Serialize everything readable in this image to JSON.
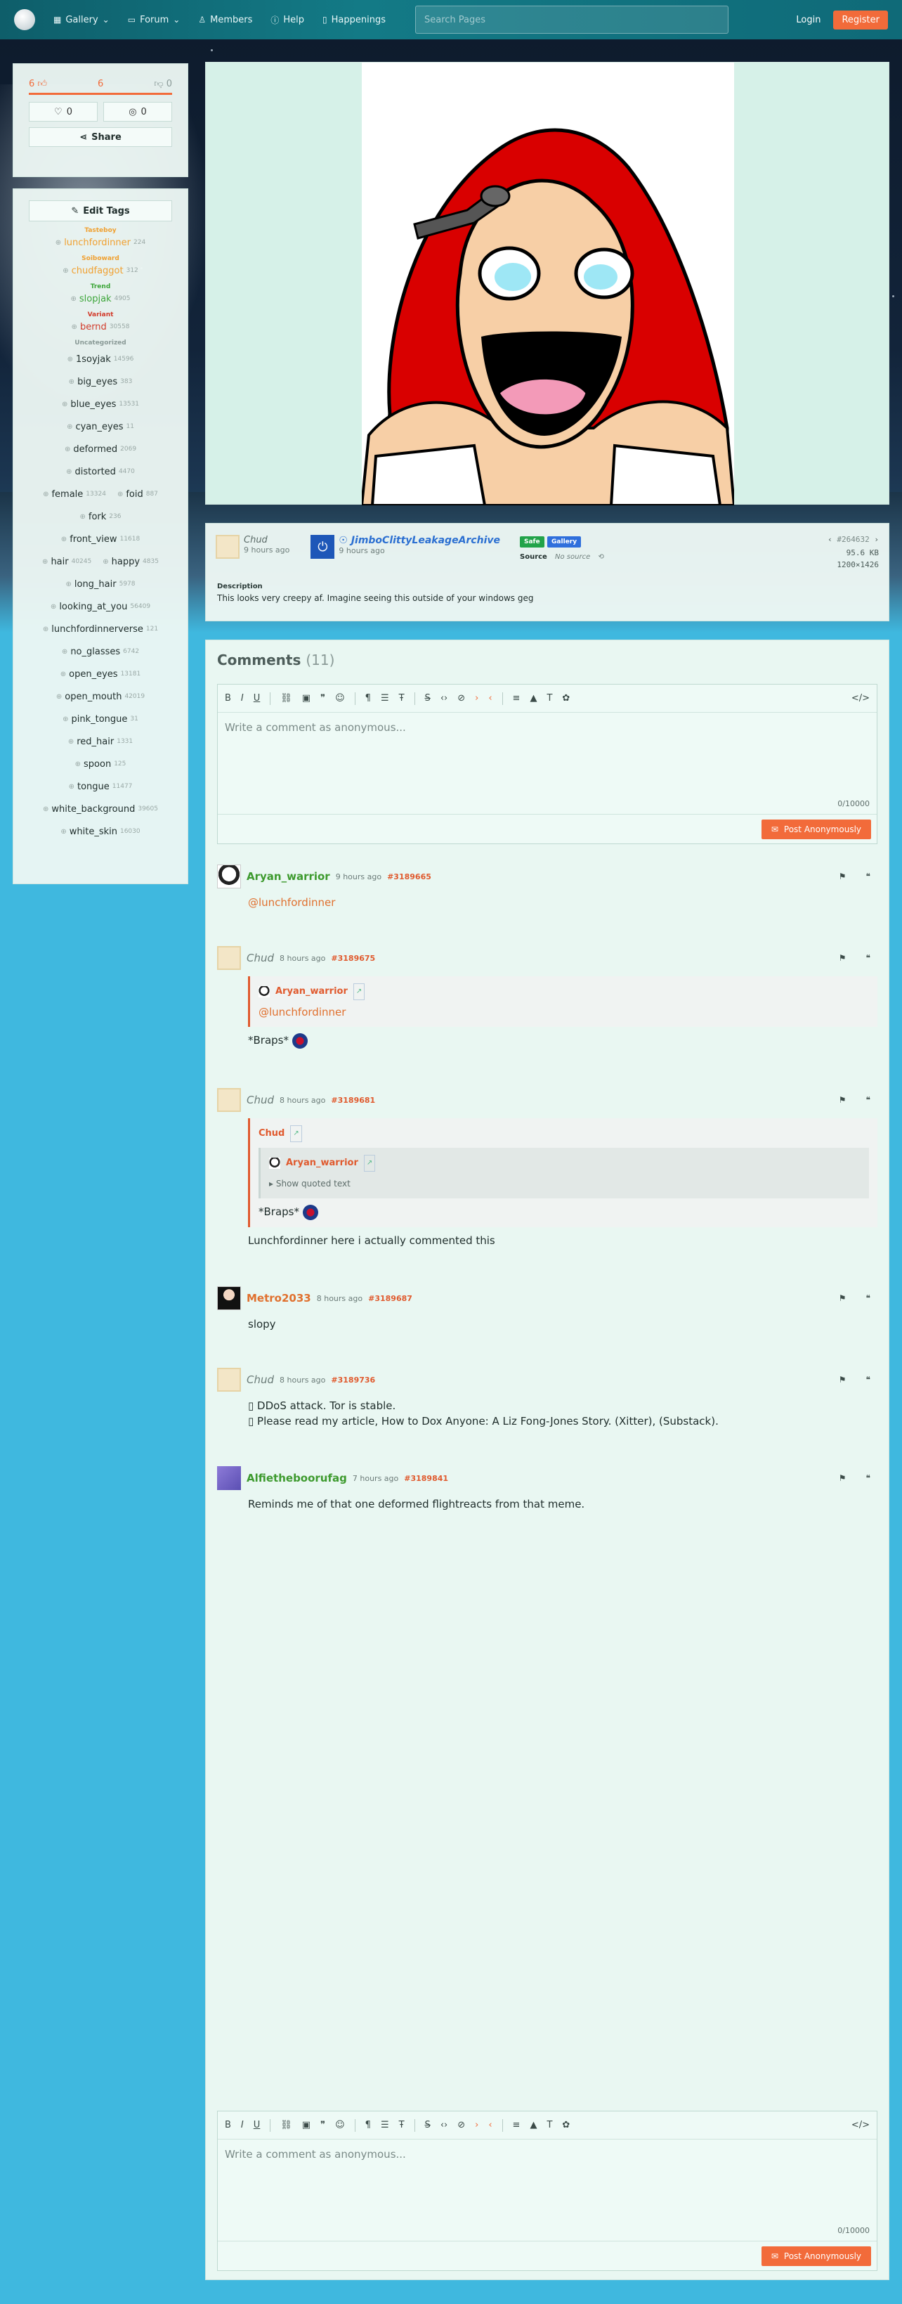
{
  "nav": {
    "gallery": "Gallery",
    "forum": "Forum",
    "members": "Members",
    "help": "Help",
    "happenings": "Happenings",
    "search_placeholder": "Search Pages",
    "login": "Login",
    "register": "Register"
  },
  "stats": {
    "upvotes": "6",
    "score": "6",
    "downvotes": "0",
    "favorites": "0",
    "hidden": "0",
    "share": "Share"
  },
  "tags": {
    "edit_label": "Edit Tags",
    "groups": [
      {
        "label": "Tasteboy",
        "color": "#f0a030",
        "rows": [
          [
            {
              "name": "lunchfordinner",
              "count": "224"
            }
          ]
        ]
      },
      {
        "label": "Soiboward",
        "color": "#f0a030",
        "rows": [
          [
            {
              "name": "chudfaggot",
              "count": "312"
            }
          ]
        ]
      },
      {
        "label": "Trend",
        "color": "#3da63a",
        "rows": [
          [
            {
              "name": "slopjak",
              "count": "4905"
            }
          ]
        ]
      },
      {
        "label": "Variant",
        "color": "#d23b2b",
        "rows": [
          [
            {
              "name": "bernd",
              "count": "30558"
            }
          ]
        ]
      },
      {
        "label": "Uncategorized",
        "color": "#8a9a97",
        "rows": [
          [
            {
              "name": "1soyjak",
              "count": "14596"
            }
          ],
          [
            {
              "name": "big_eyes",
              "count": "383"
            }
          ],
          [
            {
              "name": "blue_eyes",
              "count": "13531"
            }
          ],
          [
            {
              "name": "cyan_eyes",
              "count": "11"
            }
          ],
          [
            {
              "name": "deformed",
              "count": "2069"
            }
          ],
          [
            {
              "name": "distorted",
              "count": "4470"
            }
          ],
          [
            {
              "name": "female",
              "count": "13324"
            },
            {
              "name": "foid",
              "count": "887"
            }
          ],
          [
            {
              "name": "fork",
              "count": "236"
            }
          ],
          [
            {
              "name": "front_view",
              "count": "11618"
            }
          ],
          [
            {
              "name": "hair",
              "count": "40245"
            },
            {
              "name": "happy",
              "count": "4835"
            }
          ],
          [
            {
              "name": "long_hair",
              "count": "5978"
            }
          ],
          [
            {
              "name": "looking_at_you",
              "count": "56409"
            }
          ],
          [
            {
              "name": "lunchfordinnerverse",
              "count": "121"
            }
          ],
          [
            {
              "name": "no_glasses",
              "count": "6742"
            }
          ],
          [
            {
              "name": "open_eyes",
              "count": "13181"
            }
          ],
          [
            {
              "name": "open_mouth",
              "count": "42019"
            }
          ],
          [
            {
              "name": "pink_tongue",
              "count": "31"
            }
          ],
          [
            {
              "name": "red_hair",
              "count": "1331"
            }
          ],
          [
            {
              "name": "spoon",
              "count": "125"
            }
          ],
          [
            {
              "name": "tongue",
              "count": "11477"
            }
          ],
          [
            {
              "name": "white_background",
              "count": "39605"
            }
          ],
          [
            {
              "name": "white_skin",
              "count": "16030"
            }
          ]
        ]
      }
    ]
  },
  "post": {
    "uploader_name": "Chud",
    "uploader_time": "9 hours ago",
    "approver_name": "JimboClittyLeakageArchive",
    "approver_time": "9 hours ago",
    "badge_safe": "Safe",
    "badge_gallery": "Gallery",
    "source_label": "Source",
    "source_value": "No source",
    "post_id": "#264632",
    "file_size": "95.6 KB",
    "dimensions": "1200×1426",
    "description_label": "Description",
    "description": "This looks very creepy af. Imagine seeing this outside of your windows geg"
  },
  "comments": {
    "title": "Comments",
    "count": "(11)",
    "placeholder_top": "Write a comment as anonymous...",
    "placeholder_bottom": "Write a comment as anonymous...",
    "char_count": "0/10000",
    "post_button": "Post Anonymously",
    "items": [
      {
        "author": "Aryan_warrior",
        "time": "9 hours ago",
        "id": "#3189665",
        "text": "@lunchfordinner"
      },
      {
        "author": "Chud",
        "time": "8 hours ago",
        "id": "#3189675",
        "quote_author": "Aryan_warrior",
        "quote_text": "@lunchfordinner",
        "text": "*Braps*"
      },
      {
        "author": "Chud",
        "time": "8 hours ago",
        "id": "#3189681",
        "quote_author": "Chud",
        "inner_quote_author": "Aryan_warrior",
        "show_quoted": "Show quoted text",
        "quote_text": "*Braps*",
        "text": "Lunchfordinner here i actually commented this"
      },
      {
        "author": "Metro2033",
        "time": "8 hours ago",
        "id": "#3189687",
        "text": "slopy"
      },
      {
        "author": "Chud",
        "time": "8 hours ago",
        "id": "#3189736",
        "line1": "DDoS attack. Tor is stable.",
        "line2": "Please read my article, How to Dox Anyone: A Liz Fong-Jones Story. (Xitter), (Substack)."
      },
      {
        "author": "Alfietheboorufag",
        "time": "7 hours ago",
        "id": "#3189841",
        "text": "Reminds me of that one deformed flightreacts from that meme."
      }
    ]
  },
  "colors": {
    "accent": "#f26b3a",
    "nav": "#137a86",
    "green": "#3d9a2e",
    "blue": "#2b6fd1"
  }
}
